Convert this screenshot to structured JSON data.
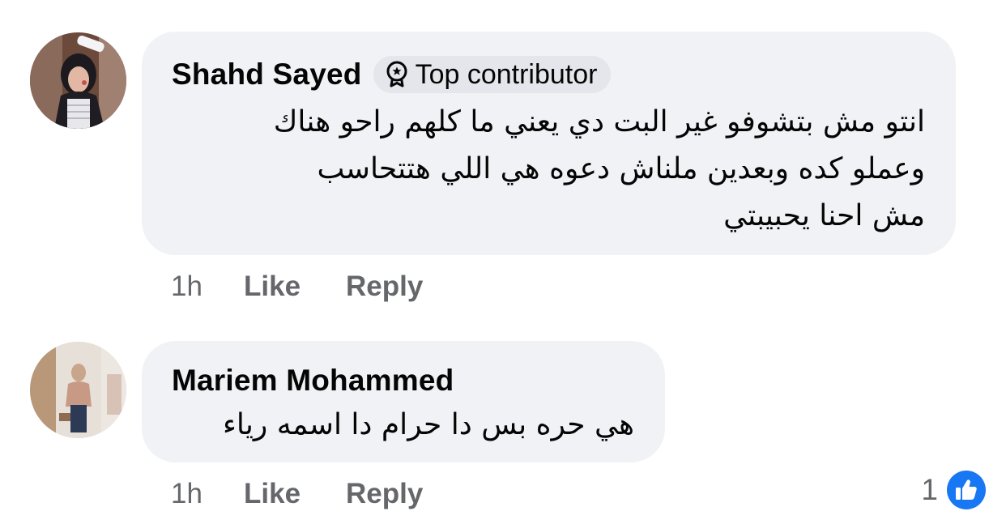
{
  "comments": [
    {
      "author": "Shahd Sayed",
      "badge": "Top contributor",
      "text_lines": [
        "انتو مش بتشوفو غير البت دي يعني ما كلهم راحو هناك",
        "وعملو كده وبعدين ملناش دعوه هي اللي هتتحاسب",
        "مش احنا يحبيبتي"
      ],
      "time": "1h",
      "like_label": "Like",
      "reply_label": "Reply"
    },
    {
      "author": "Mariem Mohammed",
      "text_lines": [
        "هي حره بس دا حرام دا اسمه رياء"
      ],
      "time": "1h",
      "like_label": "Like",
      "reply_label": "Reply",
      "reaction_count": "1",
      "reaction_icon": "like-reaction-icon"
    }
  ],
  "colors": {
    "bubble_bg": "#f0f2f5",
    "badge_bg": "#e4e6eb",
    "text_primary": "#050505",
    "text_secondary": "#65676b",
    "accent_blue": "#1877f2"
  }
}
